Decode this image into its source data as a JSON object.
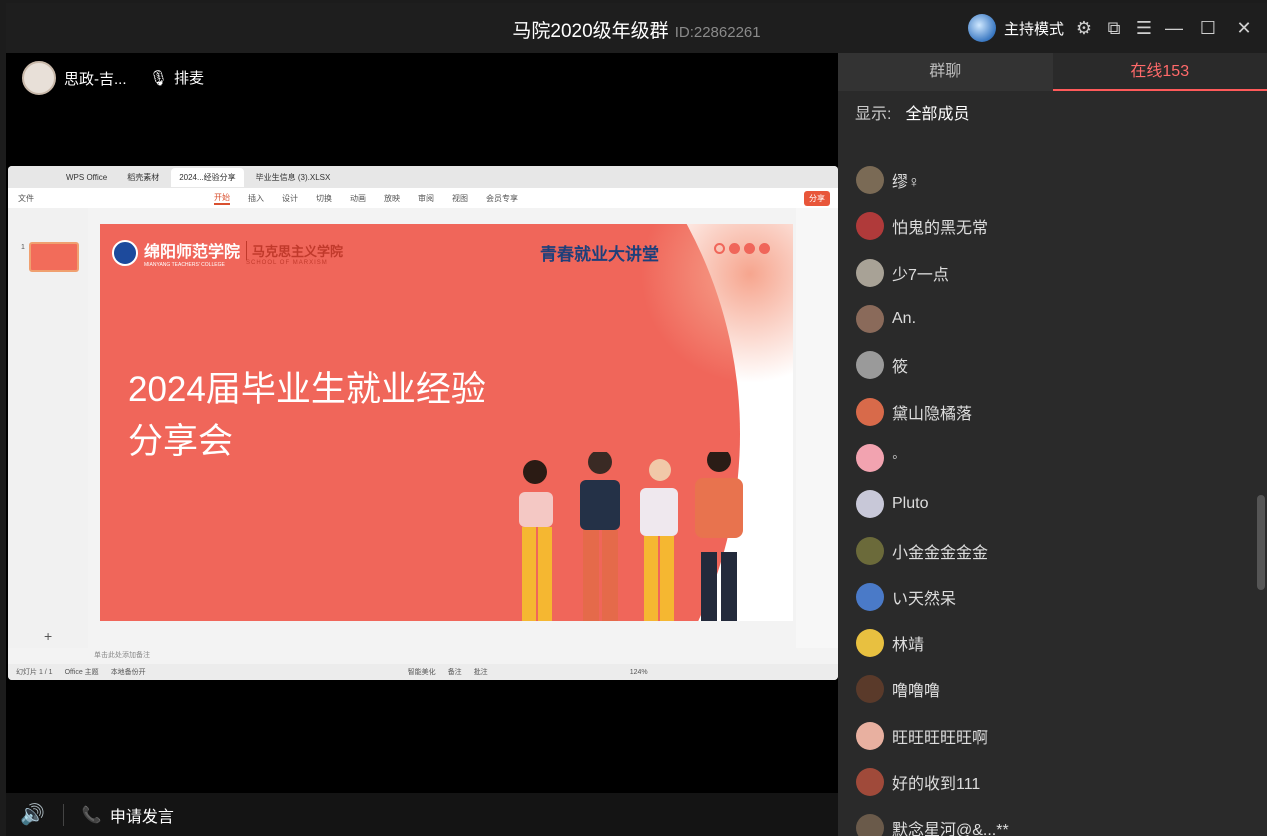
{
  "window": {
    "title": "马院2020级年级群",
    "group_id": "ID:22862261",
    "host_mode_label": "主持模式"
  },
  "stage": {
    "presenter_name": "思政-吉...",
    "mic_queue_label": "排麦"
  },
  "wps": {
    "tabs": [
      "WPS Office",
      "稻壳素材",
      "2024...经验分享",
      "毕业生信息 (3).XLSX"
    ],
    "file_label": "文件",
    "ribbon": [
      "开始",
      "插入",
      "设计",
      "切换",
      "动画",
      "放映",
      "审阅",
      "视图",
      "会员专享"
    ],
    "share_label": "分享",
    "slide_number": "1",
    "notes_placeholder": "单击此处添加备注",
    "status": {
      "slide_count": "幻灯片 1 / 1",
      "theme": "Office 主题",
      "backup": "本地备份开",
      "beautify": "智能美化",
      "notes": "备注",
      "comments": "批注",
      "zoom": "124%"
    },
    "slide": {
      "school_cn": "绵阳师范学院",
      "school_en": "MIANYANG TEACHERS' COLLEGE",
      "college_cn": "马克思主义学院",
      "college_en": "SCHOOL OF MARXISM",
      "lecture": "青春就业大讲堂",
      "title_line1": "2024届毕业生就业经验",
      "title_line2": "分享会"
    }
  },
  "bottom_bar": {
    "apply_speak_label": "申请发言"
  },
  "panel": {
    "tabs": [
      "群聊",
      "在线153"
    ],
    "filter_label": "显示:",
    "filter_value": "全部成员",
    "members": [
      {
        "name": "缪♀",
        "color": "#7a6a55"
      },
      {
        "name": "怕鬼的黑无常",
        "color": "#b03a3a"
      },
      {
        "name": "少7一点",
        "color": "#a8a296"
      },
      {
        "name": "An.",
        "color": "#8a6a5a"
      },
      {
        "name": "筱",
        "color": "#9a9a9a"
      },
      {
        "name": "黛山隐橘落",
        "color": "#d86a4a"
      },
      {
        "name": "◦",
        "color": "#f2a3b0"
      },
      {
        "name": "Pluto",
        "color": "#c8c8d8"
      },
      {
        "name": "小金金金金金",
        "color": "#6b6a3a"
      },
      {
        "name": "い天然呆",
        "color": "#4a7ac8"
      },
      {
        "name": "林靖",
        "color": "#e8c040"
      },
      {
        "name": "噜噜噜",
        "color": "#5a3a2a"
      },
      {
        "name": "旺旺旺旺旺啊",
        "color": "#e8b0a0"
      },
      {
        "name": "好的收到111",
        "color": "#a04a3a"
      },
      {
        "name": "默念星河@&...**",
        "color": "#6a5a4a"
      }
    ]
  }
}
